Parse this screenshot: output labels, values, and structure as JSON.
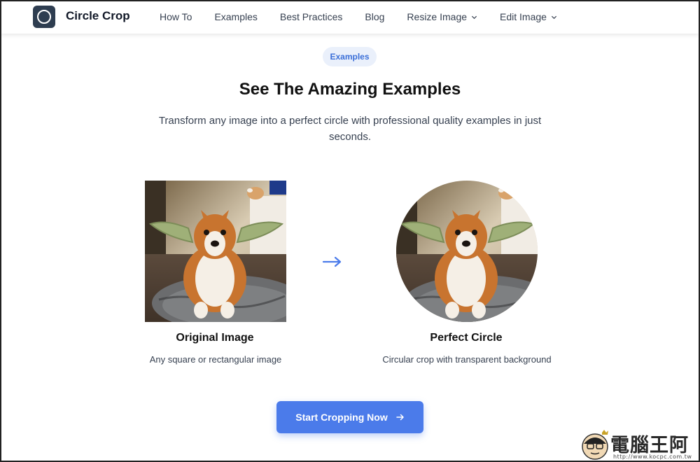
{
  "header": {
    "brand": "Circle Crop",
    "nav": [
      {
        "label": "How To",
        "has_dropdown": false
      },
      {
        "label": "Examples",
        "has_dropdown": false
      },
      {
        "label": "Best Practices",
        "has_dropdown": false
      },
      {
        "label": "Blog",
        "has_dropdown": false
      },
      {
        "label": "Resize Image",
        "has_dropdown": true
      },
      {
        "label": "Edit Image",
        "has_dropdown": true
      }
    ]
  },
  "section": {
    "badge": "Examples",
    "title": "See The Amazing Examples",
    "subtitle": "Transform any image into a perfect circle with professional quality examples in just seconds."
  },
  "original": {
    "title": "Original Image",
    "desc": "Any square or rectangular image"
  },
  "result": {
    "title": "Perfect Circle",
    "desc": "Circular crop with transparent background"
  },
  "cta": {
    "label": "Start Cropping Now"
  },
  "watermark": {
    "text": "電腦王阿達",
    "url": "http://www.kocpc.com.tw"
  },
  "colors": {
    "accent": "#4b7bea",
    "badge_bg": "#eaf0fb",
    "badge_text": "#3b6fd8",
    "logo_bg": "#2e3d50"
  },
  "icons": {
    "logo": "circle-logo-icon",
    "arrow": "arrow-right-icon",
    "chevron": "chevron-down-icon"
  }
}
